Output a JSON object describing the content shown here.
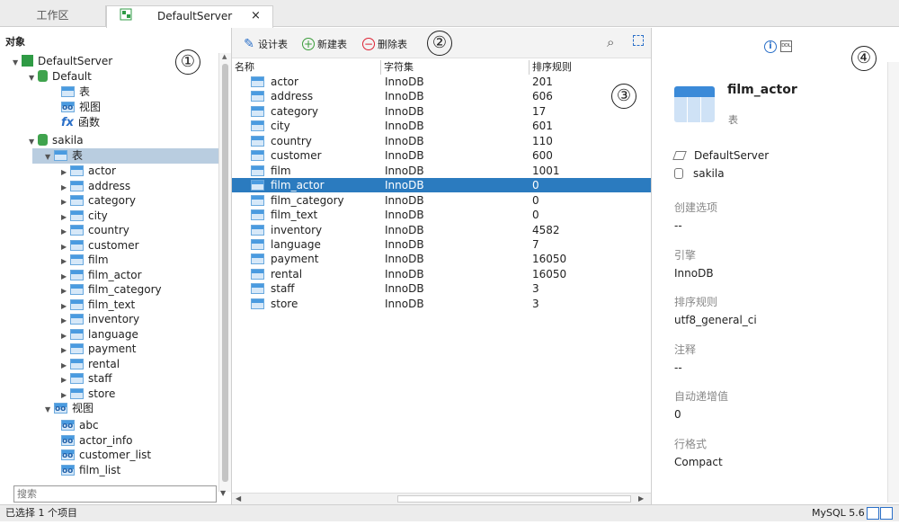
{
  "tabs": {
    "work": "工作区",
    "server": "DefaultServer",
    "close": "×"
  },
  "left": {
    "objects_title": "对象",
    "server": "DefaultServer",
    "db_default": "Default",
    "default_children": [
      "表",
      "视图",
      "函数"
    ],
    "db_sakila": "sakila",
    "tables_node": "表",
    "tables": [
      "actor",
      "address",
      "category",
      "city",
      "country",
      "customer",
      "film",
      "film_actor",
      "film_category",
      "film_text",
      "inventory",
      "language",
      "payment",
      "rental",
      "staff",
      "store"
    ],
    "views_node": "视图",
    "views": [
      "abc",
      "actor_info",
      "customer_list",
      "film_list"
    ],
    "search_placeholder": "搜索"
  },
  "toolbar": {
    "design": "设计表",
    "new": "新建表",
    "delete": "删除表"
  },
  "columns": [
    "名称",
    "字符集",
    "排序规则"
  ],
  "rows": [
    {
      "name": "actor",
      "charset": "InnoDB",
      "rule": "201"
    },
    {
      "name": "address",
      "charset": "InnoDB",
      "rule": "606"
    },
    {
      "name": "category",
      "charset": "InnoDB",
      "rule": "17"
    },
    {
      "name": "city",
      "charset": "InnoDB",
      "rule": "601"
    },
    {
      "name": "country",
      "charset": "InnoDB",
      "rule": "110"
    },
    {
      "name": "customer",
      "charset": "InnoDB",
      "rule": "600"
    },
    {
      "name": "film",
      "charset": "InnoDB",
      "rule": "1001"
    },
    {
      "name": "film_actor",
      "charset": "InnoDB",
      "rule": "0"
    },
    {
      "name": "film_category",
      "charset": "InnoDB",
      "rule": "0"
    },
    {
      "name": "film_text",
      "charset": "InnoDB",
      "rule": "0"
    },
    {
      "name": "inventory",
      "charset": "InnoDB",
      "rule": "4582"
    },
    {
      "name": "language",
      "charset": "InnoDB",
      "rule": "7"
    },
    {
      "name": "payment",
      "charset": "InnoDB",
      "rule": "16050"
    },
    {
      "name": "rental",
      "charset": "InnoDB",
      "rule": "16050"
    },
    {
      "name": "staff",
      "charset": "InnoDB",
      "rule": "3"
    },
    {
      "name": "store",
      "charset": "InnoDB",
      "rule": "3"
    }
  ],
  "selected_row": "film_actor",
  "detail": {
    "name": "film_actor",
    "type": "表",
    "server": "DefaultServer",
    "database": "sakila",
    "fields": [
      {
        "label": "创建选项",
        "value": "--"
      },
      {
        "label": "引擎",
        "value": "InnoDB"
      },
      {
        "label": "排序规则",
        "value": "utf8_general_ci"
      },
      {
        "label": "注释",
        "value": "--"
      },
      {
        "label": "自动递增值",
        "value": "0"
      },
      {
        "label": "行格式",
        "value": "Compact"
      }
    ],
    "ddl_icon_text": "DDL"
  },
  "annotations": [
    "①",
    "②",
    "③",
    "④"
  ],
  "status": {
    "left": "已选择 1 个项目",
    "right": "MySQL 5.6"
  },
  "colors": {
    "selection": "#2b7bbf",
    "tree_selection": "#b9cde0",
    "accent": "#2a6fc8"
  }
}
